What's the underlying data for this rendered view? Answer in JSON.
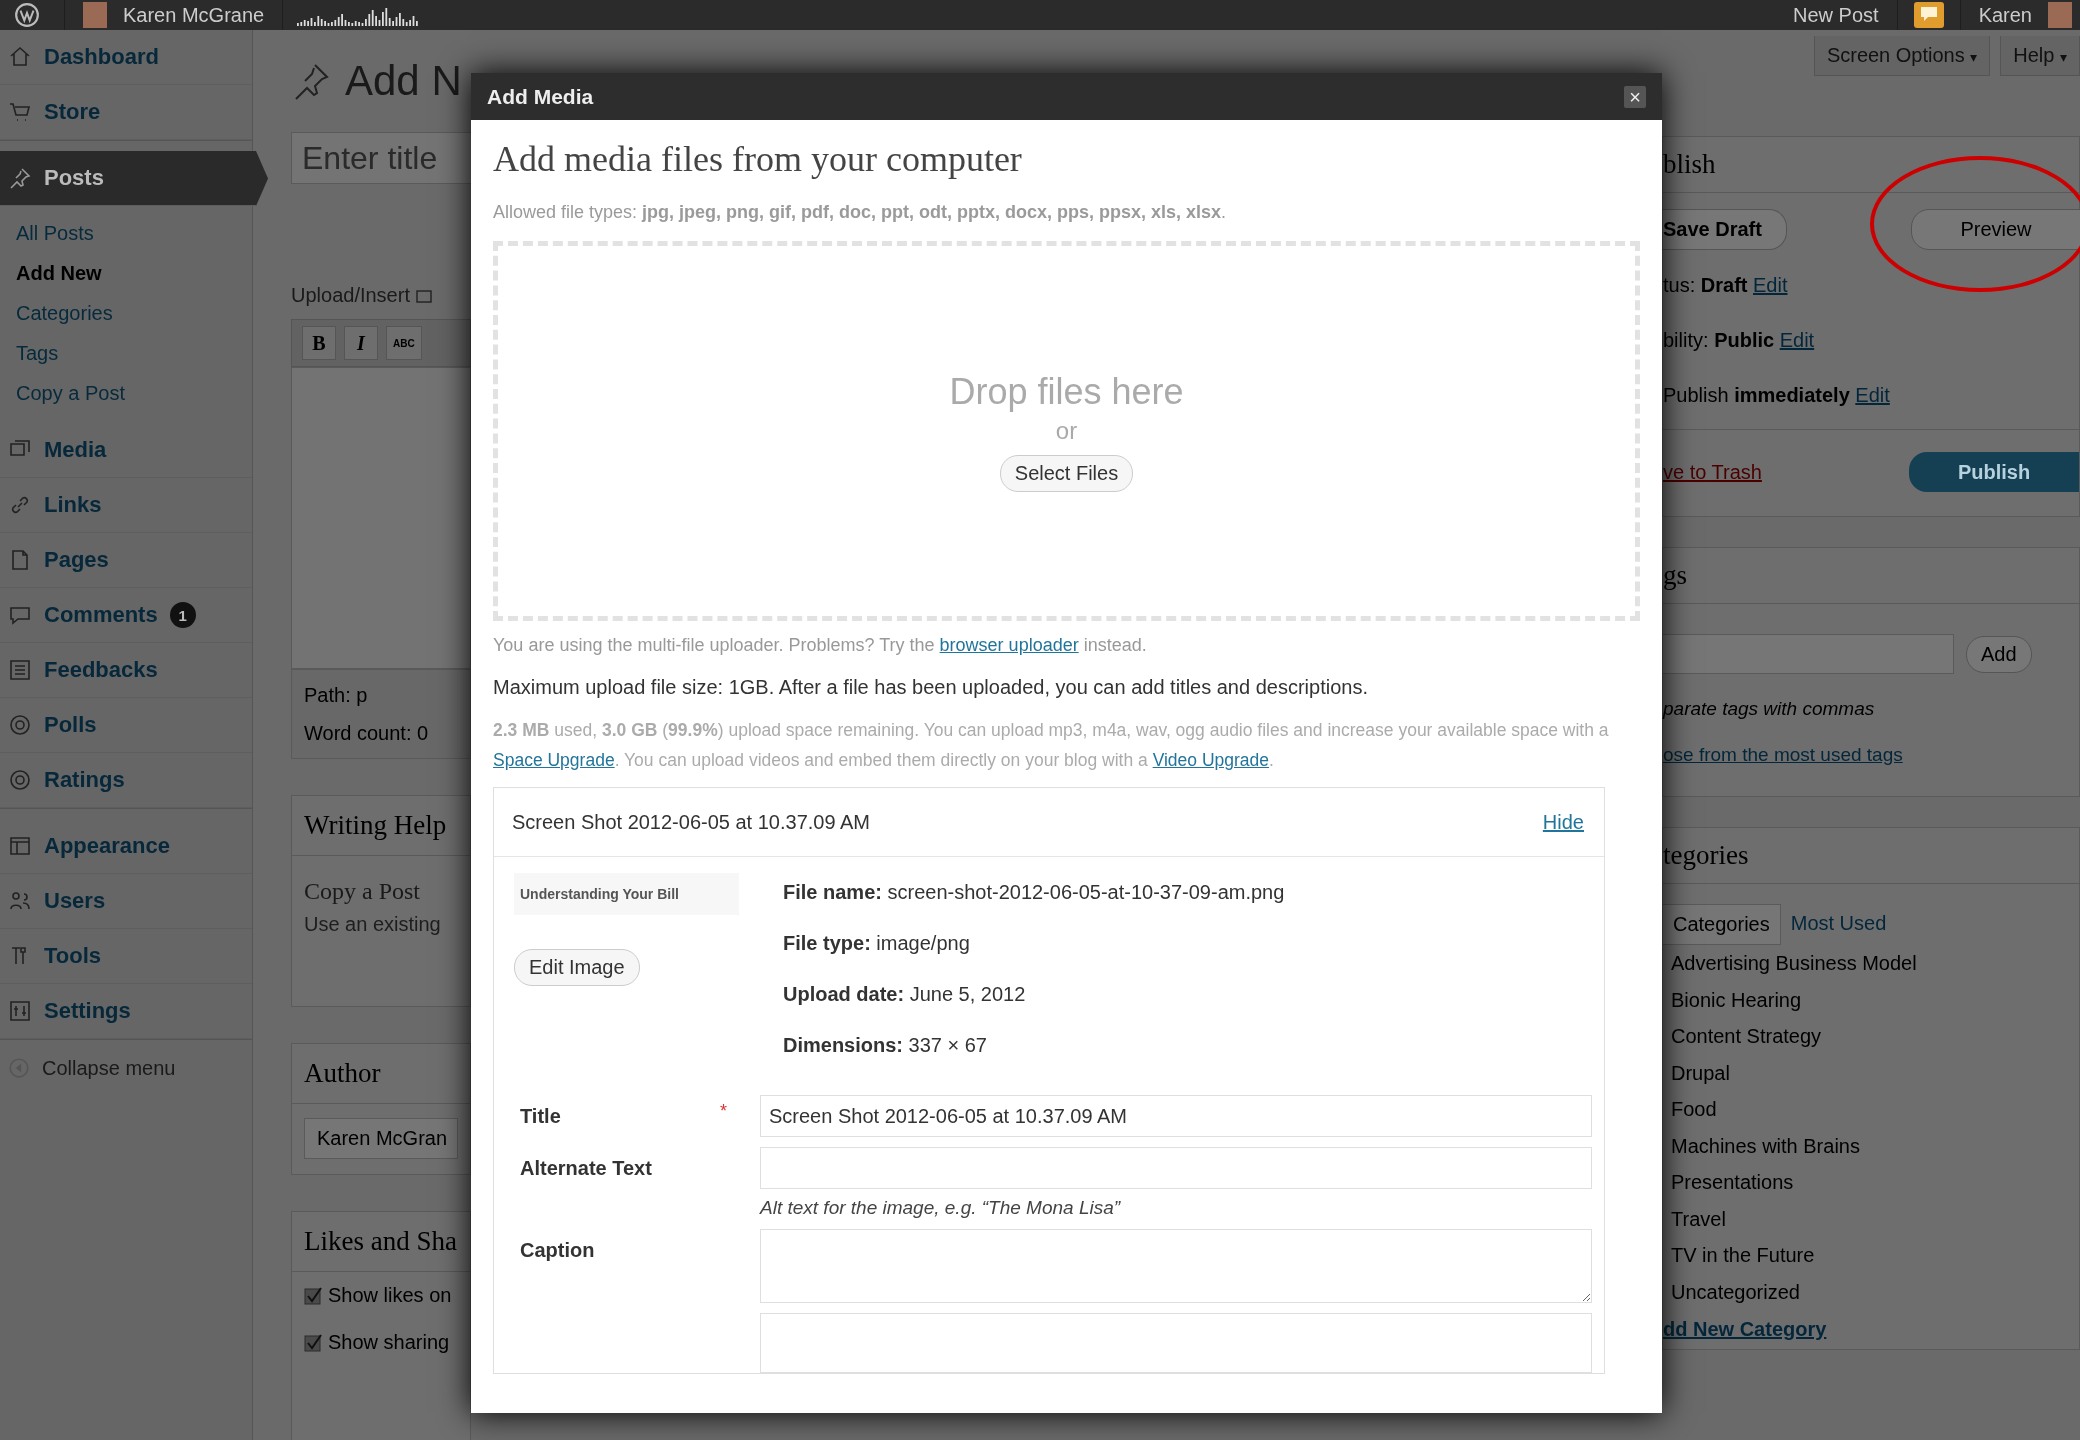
{
  "admin_bar": {
    "user": "Karen McGrane",
    "new_post": "New Post",
    "account": "Karen"
  },
  "screen_options": {
    "label": "Screen Options",
    "caret": "▾"
  },
  "help": {
    "label": "Help",
    "caret": "▾"
  },
  "sidebar": {
    "groups": [
      [
        {
          "label": "Dashboard",
          "selected": false
        },
        {
          "label": "Store",
          "selected": false
        }
      ],
      [
        {
          "label": "Posts",
          "selected": true,
          "children": [
            {
              "label": "All Posts",
              "selected": false
            },
            {
              "label": "Add New",
              "selected": true
            },
            {
              "label": "Categories",
              "selected": false
            },
            {
              "label": "Tags",
              "selected": false
            },
            {
              "label": "Copy a Post",
              "selected": false
            }
          ]
        },
        {
          "label": "Media",
          "selected": false
        },
        {
          "label": "Links",
          "selected": false
        },
        {
          "label": "Pages",
          "selected": false
        },
        {
          "label": "Comments",
          "selected": false,
          "badge": "1"
        },
        {
          "label": "Feedbacks",
          "selected": false
        },
        {
          "label": "Polls",
          "selected": false
        },
        {
          "label": "Ratings",
          "selected": false
        }
      ],
      [
        {
          "label": "Appearance",
          "selected": false
        },
        {
          "label": "Users",
          "selected": false
        },
        {
          "label": "Tools",
          "selected": false
        },
        {
          "label": "Settings",
          "selected": false
        }
      ]
    ],
    "collapse": "Collapse menu"
  },
  "editor": {
    "page_title": "Add N",
    "title_placeholder": "Enter title",
    "upload_insert": "Upload/Insert",
    "toolbar": [
      "B",
      "I",
      "ABC"
    ],
    "path": "Path: p",
    "word_count": "Word count: 0"
  },
  "writing_help": {
    "heading": "Writing Help",
    "item": "Copy a Post",
    "description": "Use an existing"
  },
  "author": {
    "heading": "Author",
    "value": "Karen McGran"
  },
  "likes": {
    "heading": "Likes and Sha",
    "options": [
      {
        "label": "Show likes on",
        "checked": true
      },
      {
        "label": "Show sharing",
        "checked": true
      }
    ]
  },
  "publish": {
    "heading": "blish",
    "save_draft": "Save Draft",
    "preview": "Preview",
    "rows": [
      {
        "label": "tus:",
        "value": "Draft",
        "link": "Edit"
      },
      {
        "label": "bility:",
        "value": "Public",
        "link": "Edit"
      },
      {
        "label": "Publish",
        "value": "immediately",
        "link": "Edit"
      }
    ],
    "trash": "ve to Trash",
    "publish": "Publish"
  },
  "tags": {
    "heading": "gs",
    "add": "Add",
    "hint": "parate tags with commas",
    "link": "ose from the most used tags"
  },
  "categories": {
    "heading": "tegories",
    "tabs": [
      {
        "label": "Categories",
        "selected": true
      },
      {
        "label": "Most Used",
        "selected": false
      }
    ],
    "items": [
      "Advertising Business Model",
      "Bionic Hearing",
      "Content Strategy",
      "Drupal",
      "Food",
      "Machines with Brains",
      "Presentations",
      "Travel",
      "TV in the Future",
      "Uncategorized"
    ],
    "add_new": "dd New Category"
  },
  "modal": {
    "title": "Add Media",
    "close": "×",
    "heading": "Add media files from your computer",
    "allowed": "Allowed file types: **jpg, jpeg, png, gif, pdf, doc, ppt, odt, pptx, docx, pps, ppsx, xls, xlsx**.",
    "drop": "Drop files here",
    "or": "or",
    "select": "Select Files",
    "uploader_note": [
      {
        "kind": "text",
        "text": "You are using the multi-file uploader. Problems? Try the "
      },
      {
        "kind": "link",
        "text": "browser uploader"
      },
      {
        "kind": "text",
        "text": " instead."
      }
    ],
    "max_size": "Maximum upload file size: 1GB. After a file has been uploaded, you can add titles and descriptions.",
    "space": [
      {
        "kind": "text",
        "text": "**2.3 MB** used, **3.0 GB** (**99.9%**) upload space remaining. You can upload mp3, m4a, wav, ogg audio files and increase your available space with a "
      },
      {
        "kind": "link",
        "text": "Space Upgrade"
      },
      {
        "kind": "text",
        "text": ". You can upload videos and embed them directly on your blog with a "
      },
      {
        "kind": "link",
        "text": "Video Upgrade"
      },
      {
        "kind": "text",
        "text": "."
      }
    ],
    "file": {
      "name": "Screen Shot 2012-06-05 at 10.37.09 AM",
      "hide": "Hide",
      "thumbnail_text": "Understanding Your Bill",
      "edit_image": "Edit Image",
      "meta": [
        {
          "label": "File name:",
          "value": "screen-shot-2012-06-05-at-10-37-09-am.png"
        },
        {
          "label": "File type:",
          "value": "image/png"
        },
        {
          "label": "Upload date:",
          "value": "June 5, 2012"
        },
        {
          "label": "Dimensions:",
          "value": "337 × 67"
        }
      ],
      "fields": [
        {
          "kind": "input",
          "label": "Title",
          "required_mark": "*",
          "value": "Screen Shot 2012-06-05 at 10.37.09 AM"
        },
        {
          "kind": "input",
          "label": "Alternate Text",
          "help": "Alt text for the image, e.g. “The Mona Lisa”"
        },
        {
          "kind": "textarea",
          "label": "Caption"
        }
      ]
    }
  }
}
